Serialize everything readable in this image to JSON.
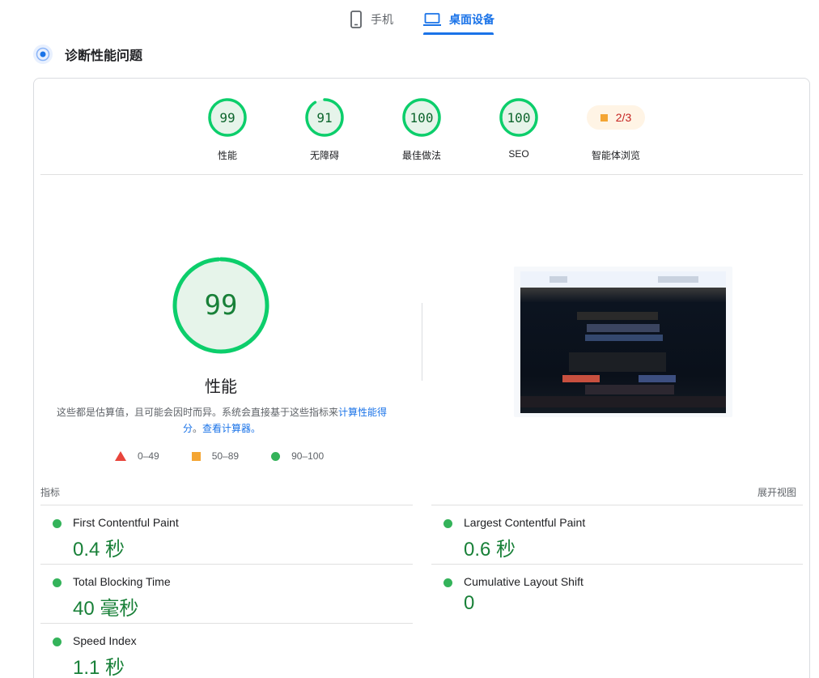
{
  "tabs": {
    "mobile_label": "手机",
    "desktop_label": "桌面设备",
    "active": "desktop"
  },
  "diagnose": {
    "title": "诊断性能问题"
  },
  "categories": [
    {
      "score": "99",
      "label": "性能",
      "fraction": 0.99
    },
    {
      "score": "91",
      "label": "无障碍",
      "fraction": 0.91
    },
    {
      "score": "100",
      "label": "最佳做法",
      "fraction": 1.0
    },
    {
      "score": "100",
      "label": "SEO",
      "fraction": 1.0
    },
    {
      "score": "2/3",
      "label": "智能体浏览"
    }
  ],
  "performance": {
    "score": "99",
    "fraction": 0.99,
    "title": "性能",
    "desc_text": "这些都是估算值，且可能会因时而异。系统会直接基于这些指标来",
    "desc_link1": "计算性能得分",
    "desc_sep": "。",
    "desc_link2": "查看计算器。"
  },
  "legend": {
    "fail": "0–49",
    "average": "50–89",
    "pass": "90–100"
  },
  "metrics": {
    "header_label": "指标",
    "expand_label": "展开视图",
    "items": [
      {
        "name": "First Contentful Paint",
        "value": "0.4 秒",
        "status": "pass"
      },
      {
        "name": "Largest Contentful Paint",
        "value": "0.6 秒",
        "status": "pass"
      },
      {
        "name": "Total Blocking Time",
        "value": "40 毫秒",
        "status": "pass"
      },
      {
        "name": "Cumulative Layout Shift",
        "value": "0",
        "status": "pass"
      },
      {
        "name": "Speed Index",
        "value": "1.1 秒",
        "status": "pass"
      }
    ]
  },
  "colors": {
    "pass": "#0cce6b",
    "pass_text": "#188038",
    "average": "#f4a533",
    "fail": "#e8453c",
    "accent": "#1a73e8"
  }
}
